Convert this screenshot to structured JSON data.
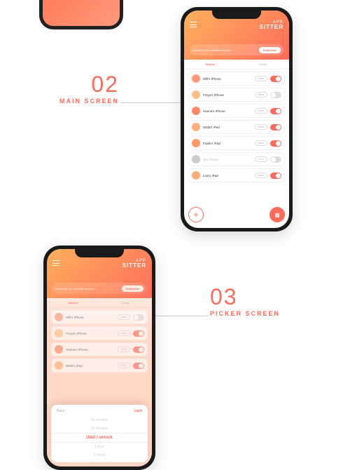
{
  "colors": {
    "accent": "#ff6b5b",
    "gradientStart": "#ffb25c",
    "gradientEnd": "#ff6b5b"
  },
  "sections": {
    "main": {
      "num": "02",
      "label": "MAIN SCREEN"
    },
    "picker": {
      "num": "03",
      "label": "PICKER SCREEN"
    }
  },
  "app": {
    "brandTop": "APP",
    "brandBottom": "SITTER",
    "bannerText": "Subscribe for unlimited devices",
    "subscribe": "Subscribe",
    "tabs": {
      "left": "Device",
      "right": "Group"
    },
    "devices": [
      {
        "name": "Will's iPhone",
        "more": "More",
        "on": true,
        "avatar": "#ff9a7a",
        "active": true
      },
      {
        "name": "Freya's iPhone",
        "more": "More",
        "on": false,
        "avatar": "#ffc08a",
        "active": true
      },
      {
        "name": "Hanna's iPhone",
        "more": "More",
        "on": true,
        "avatar": "#ff8a6a",
        "active": true
      },
      {
        "name": "Wafa's iPad",
        "more": "More",
        "on": true,
        "avatar": "#ffb07a",
        "active": true
      },
      {
        "name": "Frank's iPad",
        "more": "More",
        "on": true,
        "avatar": "#ff9a6a",
        "active": true
      },
      {
        "name": "Test Phone",
        "more": "More",
        "on": false,
        "avatar": "#cccccc",
        "active": false
      },
      {
        "name": "Lisa's iPad",
        "more": "More",
        "on": true,
        "avatar": "#ffad7a",
        "active": true
      }
    ],
    "fab": {
      "add": "+",
      "lock": "🔒"
    }
  },
  "picker": {
    "back": "Back",
    "lock": "Lock",
    "options": [
      "30 minutes",
      "15 minutes",
      "Until I unlock",
      "1 hour",
      "2 hours"
    ],
    "visibleDevices": [
      {
        "name": "Will's iPhone",
        "more": "More",
        "on": false,
        "avatar": "#ff9a7a"
      },
      {
        "name": "Freya's iPhone",
        "more": "More",
        "on": true,
        "avatar": "#ffc08a"
      },
      {
        "name": "Hanna's iPhone",
        "more": "More",
        "on": true,
        "avatar": "#ff8a6a"
      },
      {
        "name": "Wafa's iPad",
        "more": "More",
        "on": true,
        "avatar": "#ffb07a"
      }
    ]
  }
}
